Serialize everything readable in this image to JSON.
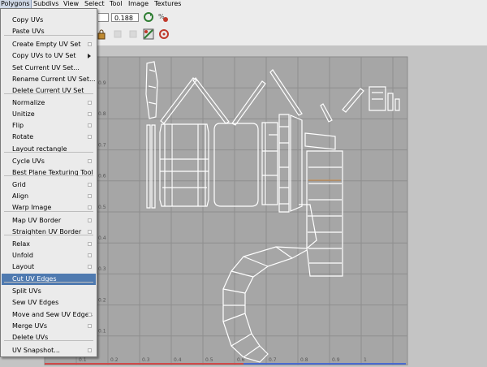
{
  "menubar": {
    "items": [
      "Polygons",
      "Subdivs",
      "View",
      "Select",
      "Tool",
      "Image",
      "Textures"
    ],
    "active": "Polygons"
  },
  "toolbar": {
    "value_field": "0.188"
  },
  "colors": {
    "grid_background": "#a6a6a6",
    "grid_line": "#8e8e8e",
    "uv_edge": "#ffffff",
    "highlight": "#4f7ab0",
    "red_icon": "#c0392b",
    "green_icon": "#2e7d32"
  },
  "uv_grid": {
    "x_ticks": [
      "0.1",
      "0.2",
      "0.3",
      "0.4",
      "0.5",
      "0.6",
      "0.7",
      "0.8",
      "0.9",
      "1"
    ],
    "y_ticks": [
      "0.9",
      "0.8",
      "0.7",
      "0.6",
      "0.5",
      "0.4",
      "0.3",
      "0.2",
      "0.1"
    ]
  },
  "menu": {
    "items": [
      {
        "label": "Copy UVs",
        "option_box": false
      },
      {
        "label": "Paste UVs",
        "option_box": false
      },
      {
        "label": "Create Empty UV Set",
        "option_box": true
      },
      {
        "label": "Copy UVs to UV Set",
        "submenu": true
      },
      {
        "label": "Set Current UV Set...",
        "option_box": false
      },
      {
        "label": "Rename Current UV Set...",
        "option_box": false
      },
      {
        "label": "Delete Current UV Set",
        "option_box": false
      },
      {
        "label": "Normalize",
        "option_box": true
      },
      {
        "label": "Unitize",
        "option_box": true
      },
      {
        "label": "Flip",
        "option_box": true
      },
      {
        "label": "Rotate",
        "option_box": true
      },
      {
        "label": "Layout rectangle",
        "option_box": false
      },
      {
        "label": "Cycle UVs",
        "option_box": true
      },
      {
        "label": "Best Plane Texturing Tool",
        "option_box": false
      },
      {
        "label": "Grid",
        "option_box": true
      },
      {
        "label": "Align",
        "option_box": true
      },
      {
        "label": "Warp Image",
        "option_box": true
      },
      {
        "label": "Map UV Border",
        "option_box": true
      },
      {
        "label": "Straighten UV Border",
        "option_box": true
      },
      {
        "label": "Relax",
        "option_box": true
      },
      {
        "label": "Unfold",
        "option_box": true
      },
      {
        "label": "Layout",
        "option_box": true
      },
      {
        "label": "Cut UV Edges",
        "option_box": false,
        "highlighted": true
      },
      {
        "label": "Split UVs",
        "option_box": false
      },
      {
        "label": "Sew UV Edges",
        "option_box": false
      },
      {
        "label": "Move and Sew UV Edges",
        "option_box": true
      },
      {
        "label": "Merge UVs",
        "option_box": true
      },
      {
        "label": "Delete UVs",
        "option_box": false
      },
      {
        "label": "UV Snapshot...",
        "option_box": true
      }
    ]
  }
}
